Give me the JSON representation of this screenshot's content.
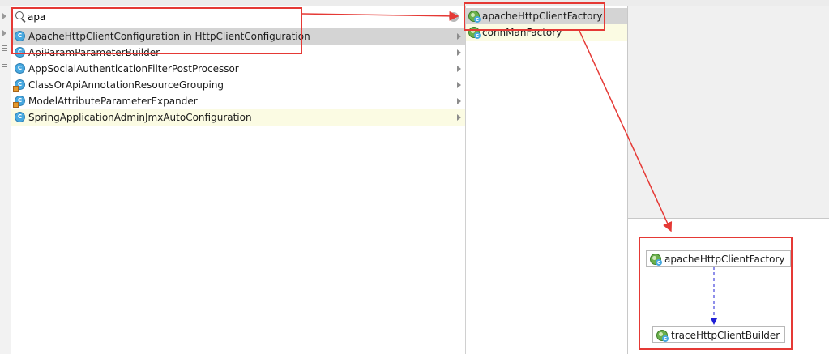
{
  "search": {
    "value": "apa",
    "clear_icon": "clear-icon"
  },
  "classes": [
    {
      "label": "ApacheHttpClientConfiguration in HttpClientConfiguration",
      "icon": "class-icon",
      "state": "selected"
    },
    {
      "label": "ApiParamParameterBuilder",
      "icon": "class-icon",
      "state": "normal"
    },
    {
      "label": "AppSocialAuthenticationFilterPostProcessor",
      "icon": "class-icon",
      "state": "normal"
    },
    {
      "label": "ClassOrApiAnnotationResourceGrouping",
      "icon": "component-class-icon",
      "state": "normal"
    },
    {
      "label": "ModelAttributeParameterExpander",
      "icon": "component-class-icon",
      "state": "normal"
    },
    {
      "label": "SpringApplicationAdminJmxAutoConfiguration",
      "icon": "class-icon",
      "state": "highlighted"
    }
  ],
  "beans": [
    {
      "label": "apacheHttpClientFactory",
      "icon": "spring-bean-icon",
      "state": "selected"
    },
    {
      "label": "connManFactory",
      "icon": "spring-bean-icon",
      "state": "highlighted"
    }
  ],
  "diagram": {
    "nodes": [
      {
        "label": "apacheHttpClientFactory",
        "icon": "spring-bean-icon"
      },
      {
        "label": "traceHttpClientBuilder",
        "icon": "spring-bean-icon"
      }
    ]
  },
  "colors": {
    "annotation_red": "#e53935",
    "dependency_blue": "#1f1fd6",
    "selected_row": "#d4d4d4",
    "highlight_row": "#fbfbe3",
    "class_icon_blue": "#47a8e0",
    "bean_icon_green": "#6ab04c"
  }
}
